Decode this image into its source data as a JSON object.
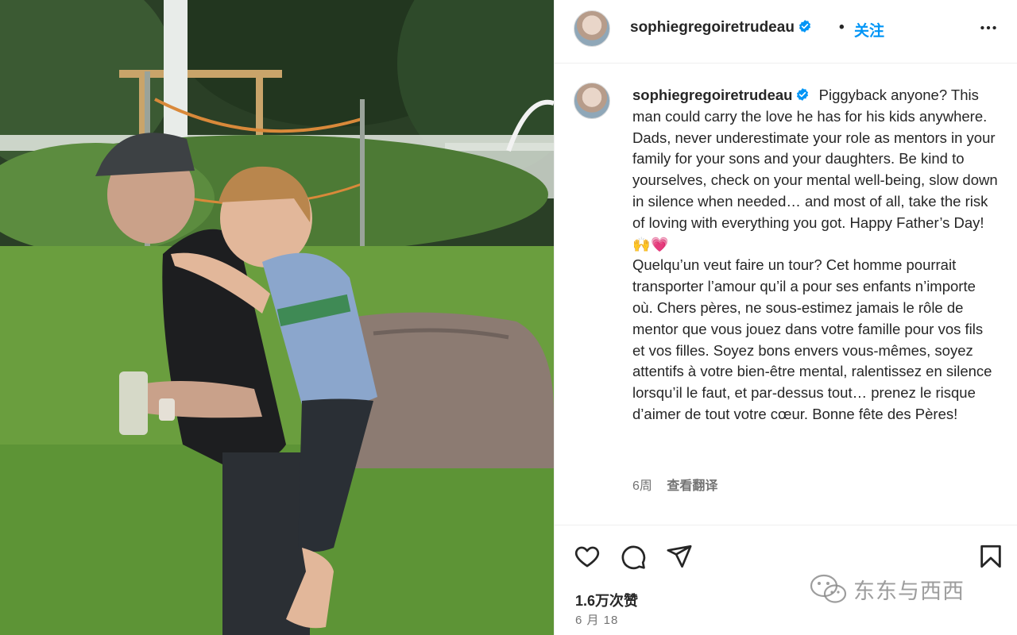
{
  "post": {
    "username": "sophiegregoiretrudeau",
    "separator": "•",
    "follow_label": "关注",
    "caption_english": "Piggyback anyone? This man could carry the love he has for his kids anywhere. Dads, never underestimate your role as mentors in your family for your sons and your daughters. Be kind to yourselves, check on your mental well-being, slow down in silence when needed… and most of all, take the risk of loving with everything you got. Happy Father’s Day!",
    "caption_emoji": "🙌💗",
    "caption_french": "Quelqu’un veut faire un tour? Cet homme pourrait transporter l’amour qu’il a pour ses enfants n’importe où. Chers pères, ne sous-estimez jamais le rôle de mentor que vous jouez dans votre famille pour vos fils et vos filles. Soyez bons envers vous-mêmes, soyez attentifs à votre bien-être mental, ralentissez en silence lorsqu’il le faut, et par-dessus tout… prenez le risque d’aimer de tout votre cœur. Bonne fête des Pères!",
    "age": "6周",
    "see_translation": "查看翻译",
    "likes": "1.6万次赞",
    "date": "6 月 18"
  },
  "icons": {
    "verified": "verified-badge-icon",
    "more": "more-options-icon",
    "like": "heart-icon",
    "comment": "comment-icon",
    "share": "send-icon",
    "save": "bookmark-icon"
  },
  "watermark": {
    "text": "东东与西西"
  },
  "colors": {
    "accent": "#0095f6",
    "text": "#262626",
    "secondary": "#737373",
    "verified": "#0095f6"
  }
}
